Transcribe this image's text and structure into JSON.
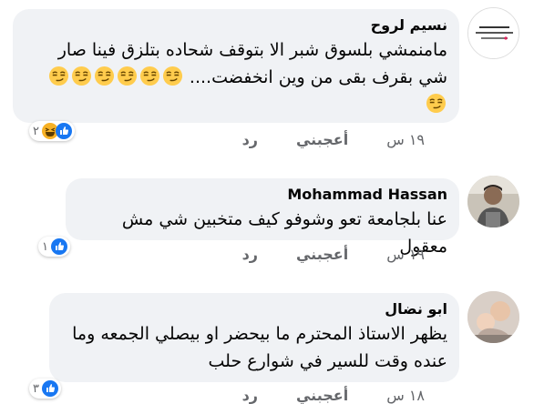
{
  "comments": [
    {
      "author": "نسيم لروح",
      "text_line1": "مامنمشي بلسوق شبر الا بتوقف شحاده بتلزق فينا صار",
      "text_line2": "شي بقرف بقى من وين انخفضت....",
      "reaction_count": "٢",
      "time": "١٩ س",
      "like_label": "أعجبني",
      "reply_label": "رد",
      "avatar_icon": "page-logo-icon",
      "reactions": [
        "like-icon",
        "haha-icon"
      ]
    },
    {
      "author": "Mohammad Hassan",
      "text_line1": "عنا بلجامعة تعو وشوفو كيف متخبين شي مش معقول",
      "reaction_count": "١",
      "time": "١٩ س",
      "like_label": "أعجبني",
      "reply_label": "رد",
      "avatar_icon": "profile-photo-icon",
      "reactions": [
        "like-icon"
      ]
    },
    {
      "author": "ابو نضال",
      "text_line1": "يظهر الاستاذ المحترم ما بيحضر او بيصلي الجمعه وما",
      "text_line2": "عنده وقت للسير في شوارع حلب",
      "reaction_count": "٣",
      "time": "١٨ س",
      "like_label": "أعجبني",
      "reply_label": "رد",
      "avatar_icon": "profile-photo-icon",
      "reactions": [
        "like-icon"
      ]
    }
  ],
  "colors": {
    "bubble": "#f0f2f5",
    "meta_text": "#65676b",
    "like_blue": "#1877f2"
  }
}
